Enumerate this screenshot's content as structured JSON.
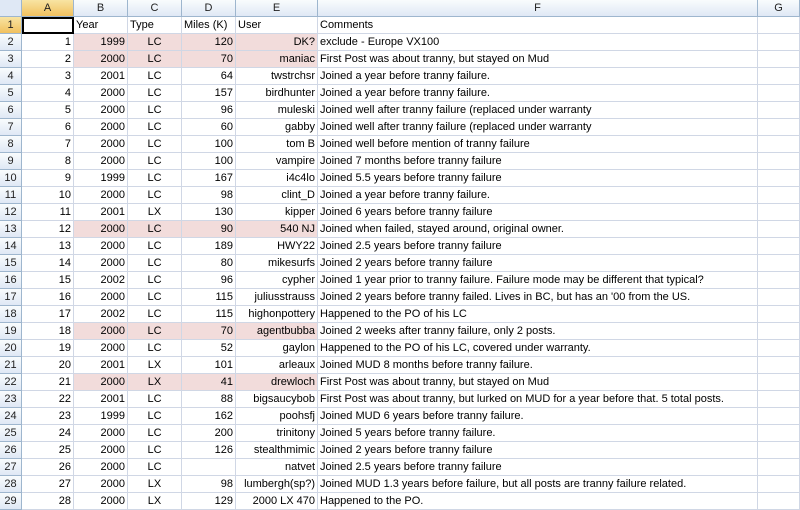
{
  "columns": [
    "A",
    "B",
    "C",
    "D",
    "E",
    "F",
    "G"
  ],
  "header_row": {
    "num": "1",
    "a": "",
    "year": "Year",
    "type": "Type",
    "miles": "Miles (K)",
    "user": "User",
    "comments": "Comments"
  },
  "rows": [
    {
      "num": "2",
      "a": "1",
      "year": "1999",
      "type": "LC",
      "miles": "120",
      "user": "DK?",
      "comments": "exclude - Europe VX100",
      "hl": true
    },
    {
      "num": "3",
      "a": "2",
      "year": "2000",
      "type": "LC",
      "miles": "70",
      "user": "maniac",
      "comments": "First Post was about tranny, but stayed on Mud",
      "hl": true
    },
    {
      "num": "4",
      "a": "3",
      "year": "2001",
      "type": "LC",
      "miles": "64",
      "user": "twstrchsr",
      "comments": "Joined a year before tranny failure.",
      "hl": false
    },
    {
      "num": "5",
      "a": "4",
      "year": "2000",
      "type": "LC",
      "miles": "157",
      "user": "birdhunter",
      "comments": "Joined a year before tranny failure.",
      "hl": false
    },
    {
      "num": "6",
      "a": "5",
      "year": "2000",
      "type": "LC",
      "miles": "96",
      "user": "muleski",
      "comments": "Joined well after tranny failure (replaced under warranty",
      "hl": false
    },
    {
      "num": "7",
      "a": "6",
      "year": "2000",
      "type": "LC",
      "miles": "60",
      "user": "gabby",
      "comments": "Joined well after tranny failure (replaced under warranty",
      "hl": false
    },
    {
      "num": "8",
      "a": "7",
      "year": "2000",
      "type": "LC",
      "miles": "100",
      "user": "tom B",
      "comments": "Joined well before mention of tranny failure",
      "hl": false
    },
    {
      "num": "9",
      "a": "8",
      "year": "2000",
      "type": "LC",
      "miles": "100",
      "user": "vampire",
      "comments": "Joined 7 months before tranny failure",
      "hl": false
    },
    {
      "num": "10",
      "a": "9",
      "year": "1999",
      "type": "LC",
      "miles": "167",
      "user": "i4c4lo",
      "comments": "Joined 5.5 years before tranny failure",
      "hl": false
    },
    {
      "num": "11",
      "a": "10",
      "year": "2000",
      "type": "LC",
      "miles": "98",
      "user": "clint_D",
      "comments": "Joined a year before tranny failure.",
      "hl": false
    },
    {
      "num": "12",
      "a": "11",
      "year": "2001",
      "type": "LX",
      "miles": "130",
      "user": "kipper",
      "comments": "Joined 6 years before tranny failure",
      "hl": false
    },
    {
      "num": "13",
      "a": "12",
      "year": "2000",
      "type": "LC",
      "miles": "90",
      "user": "540 NJ",
      "comments": "Joined when failed, stayed around, original owner.",
      "hl": true
    },
    {
      "num": "14",
      "a": "13",
      "year": "2000",
      "type": "LC",
      "miles": "189",
      "user": "HWY22",
      "comments": "Joined 2.5 years before tranny failure",
      "hl": false
    },
    {
      "num": "15",
      "a": "14",
      "year": "2000",
      "type": "LC",
      "miles": "80",
      "user": "mikesurfs",
      "comments": "Joined 2 years before tranny failure",
      "hl": false
    },
    {
      "num": "16",
      "a": "15",
      "year": "2002",
      "type": "LC",
      "miles": "96",
      "user": "cypher",
      "comments": "Joined 1 year prior to tranny failure.  Failure mode may be different that typical?",
      "hl": false
    },
    {
      "num": "17",
      "a": "16",
      "year": "2000",
      "type": "LC",
      "miles": "115",
      "user": "juliusstrauss",
      "comments": "Joined 2 years before tranny failed.  Lives in BC, but has an '00 from the US.",
      "hl": false
    },
    {
      "num": "18",
      "a": "17",
      "year": "2002",
      "type": "LC",
      "miles": "115",
      "user": "highonpottery",
      "comments": "Happened to the PO of his LC",
      "hl": false
    },
    {
      "num": "19",
      "a": "18",
      "year": "2000",
      "type": "LC",
      "miles": "70",
      "user": "agentbubba",
      "comments": "Joined 2 weeks after tranny failure, only 2 posts.",
      "hl": true
    },
    {
      "num": "20",
      "a": "19",
      "year": "2000",
      "type": "LC",
      "miles": "52",
      "user": "gaylon",
      "comments": "Happened to the PO of his LC, covered under warranty.",
      "hl": false
    },
    {
      "num": "21",
      "a": "20",
      "year": "2001",
      "type": "LX",
      "miles": "101",
      "user": "arleaux",
      "comments": "Joined MUD 8 months before tranny failure.",
      "hl": false
    },
    {
      "num": "22",
      "a": "21",
      "year": "2000",
      "type": "LX",
      "miles": "41",
      "user": "drewloch",
      "comments": "First Post was about tranny, but stayed on Mud",
      "hl": true
    },
    {
      "num": "23",
      "a": "22",
      "year": "2001",
      "type": "LC",
      "miles": "88",
      "user": "bigsaucybob",
      "comments": "First Post was about tranny, but lurked on MUD for a year before that.  5 total posts.",
      "hl": false
    },
    {
      "num": "24",
      "a": "23",
      "year": "1999",
      "type": "LC",
      "miles": "162",
      "user": "poohsfj",
      "comments": "Joined MUD 6 years before tranny failure.",
      "hl": false
    },
    {
      "num": "25",
      "a": "24",
      "year": "2000",
      "type": "LC",
      "miles": "200",
      "user": "trinitony",
      "comments": "Joined 5 years before tranny failure.",
      "hl": false
    },
    {
      "num": "26",
      "a": "25",
      "year": "2000",
      "type": "LC",
      "miles": "126",
      "user": "stealthmimic",
      "comments": "Joined 2 years before tranny failure",
      "hl": false
    },
    {
      "num": "27",
      "a": "26",
      "year": "2000",
      "type": "LC",
      "miles": "",
      "user": "natvet",
      "comments": "Joined 2.5 years before tranny failure",
      "hl": false
    },
    {
      "num": "28",
      "a": "27",
      "year": "2000",
      "type": "LX",
      "miles": "98",
      "user": "lumbergh(sp?)",
      "comments": "Joined MUD 1.3 years before failure, but all posts are tranny failure related.",
      "hl": false
    },
    {
      "num": "29",
      "a": "28",
      "year": "2000",
      "type": "LX",
      "miles": "129",
      "user": "2000 LX 470",
      "comments": "Happened to the PO.",
      "hl": false
    }
  ]
}
